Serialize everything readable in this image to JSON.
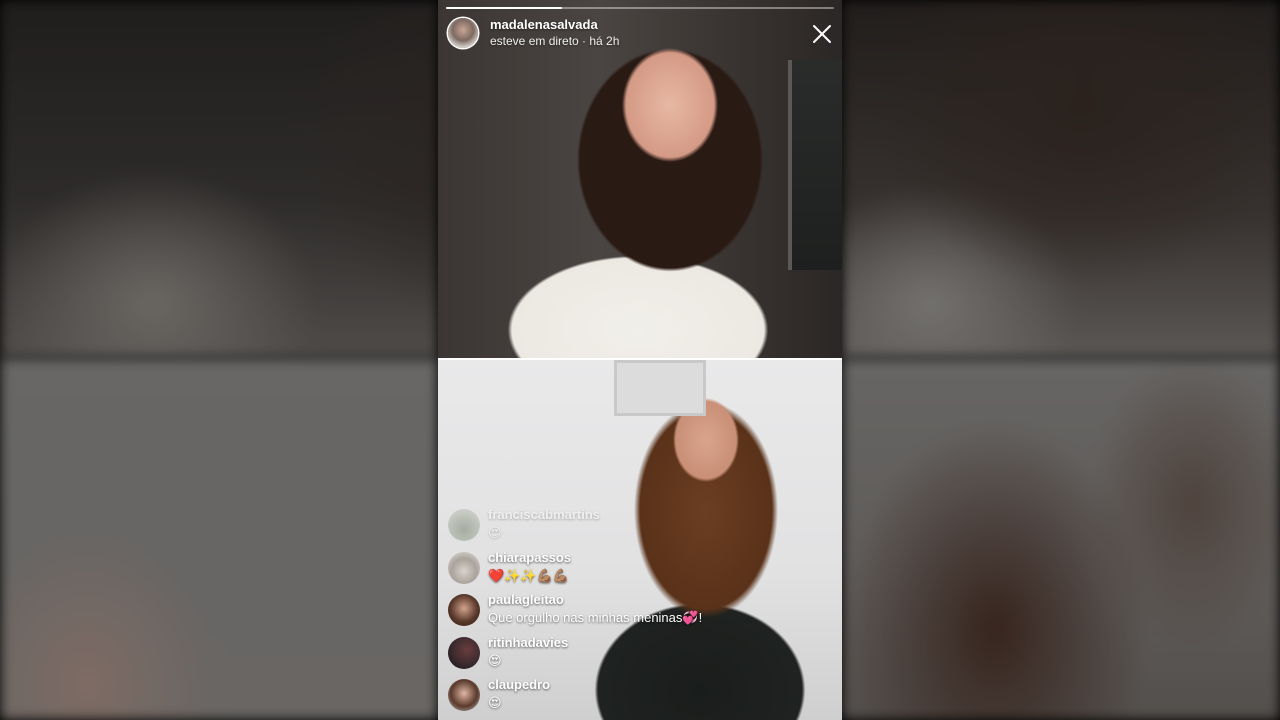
{
  "header": {
    "username": "madalenasalvada",
    "status": "esteve em direto · há 2h",
    "progress": 0.3
  },
  "icons": {
    "close": "close-icon"
  },
  "comments": [
    {
      "username": "franciscabmartins",
      "text": "😍"
    },
    {
      "username": "chiarapassos",
      "text": "❤️✨✨💪🏽💪🏽"
    },
    {
      "username": "paulagleitao",
      "text": "Que orgulho nas minhas meninas💞!"
    },
    {
      "username": "ritinhadavies",
      "text": "😍"
    },
    {
      "username": "claupedro",
      "text": "😍"
    }
  ]
}
